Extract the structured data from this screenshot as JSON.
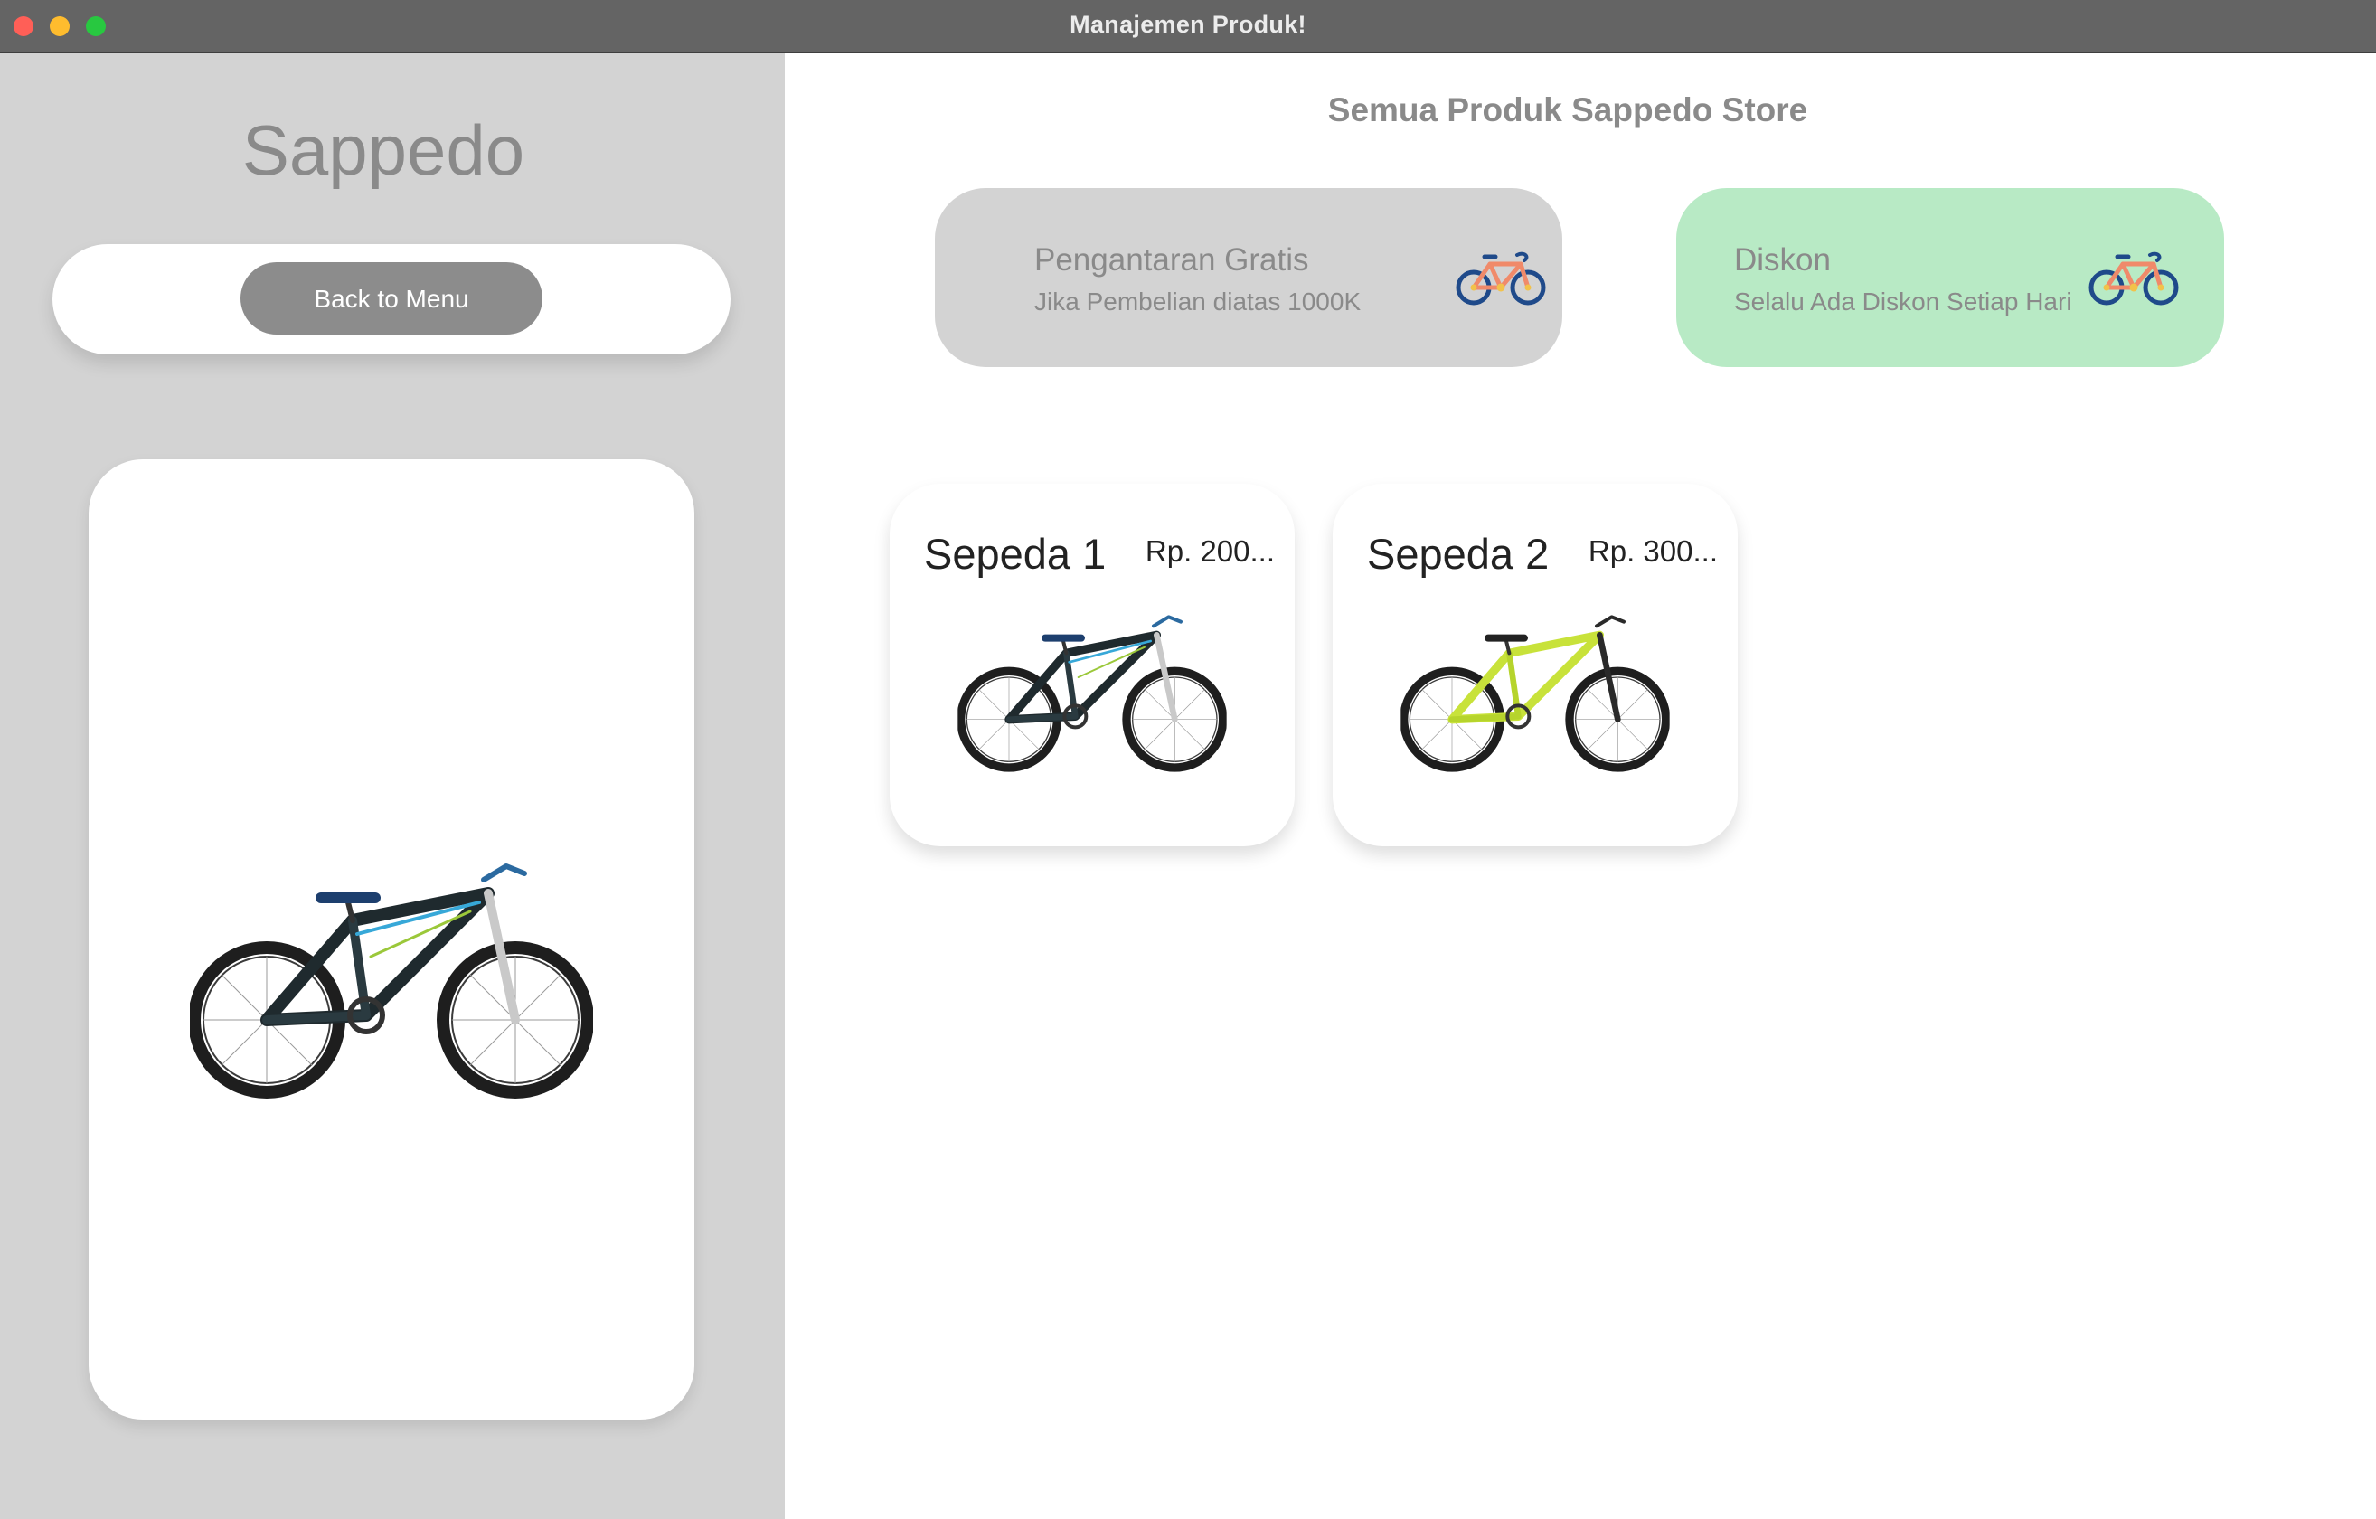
{
  "window": {
    "title": "Manajemen Produk!"
  },
  "sidebar": {
    "brand": "Sappedo",
    "back_button_label": "Back to Menu",
    "preview_image": "bike-dark-green-blue"
  },
  "main": {
    "title": "Semua Produk Sappedo Store",
    "promos": [
      {
        "title": "Pengantaran Gratis",
        "subtitle": "Jika Pembelian diatas 1000K",
        "icon": "bicycle-icon",
        "color": "#d3d3d3"
      },
      {
        "title": "Diskon",
        "subtitle": "Selalu Ada Diskon Setiap Hari",
        "icon": "bicycle-icon",
        "color": "#b8eac5"
      }
    ],
    "products": [
      {
        "name": "Sepeda 1",
        "price": "Rp. 200...",
        "image": "bike-dark-green-blue"
      },
      {
        "name": "Sepeda 2",
        "price": "Rp. 300...",
        "image": "bike-lime"
      }
    ]
  },
  "colors": {
    "titlebar": "#646464",
    "sidebar": "#d3d3d3",
    "button": "#8c8c8c",
    "promo_gray": "#d3d3d3",
    "promo_green": "#b8eac5"
  }
}
